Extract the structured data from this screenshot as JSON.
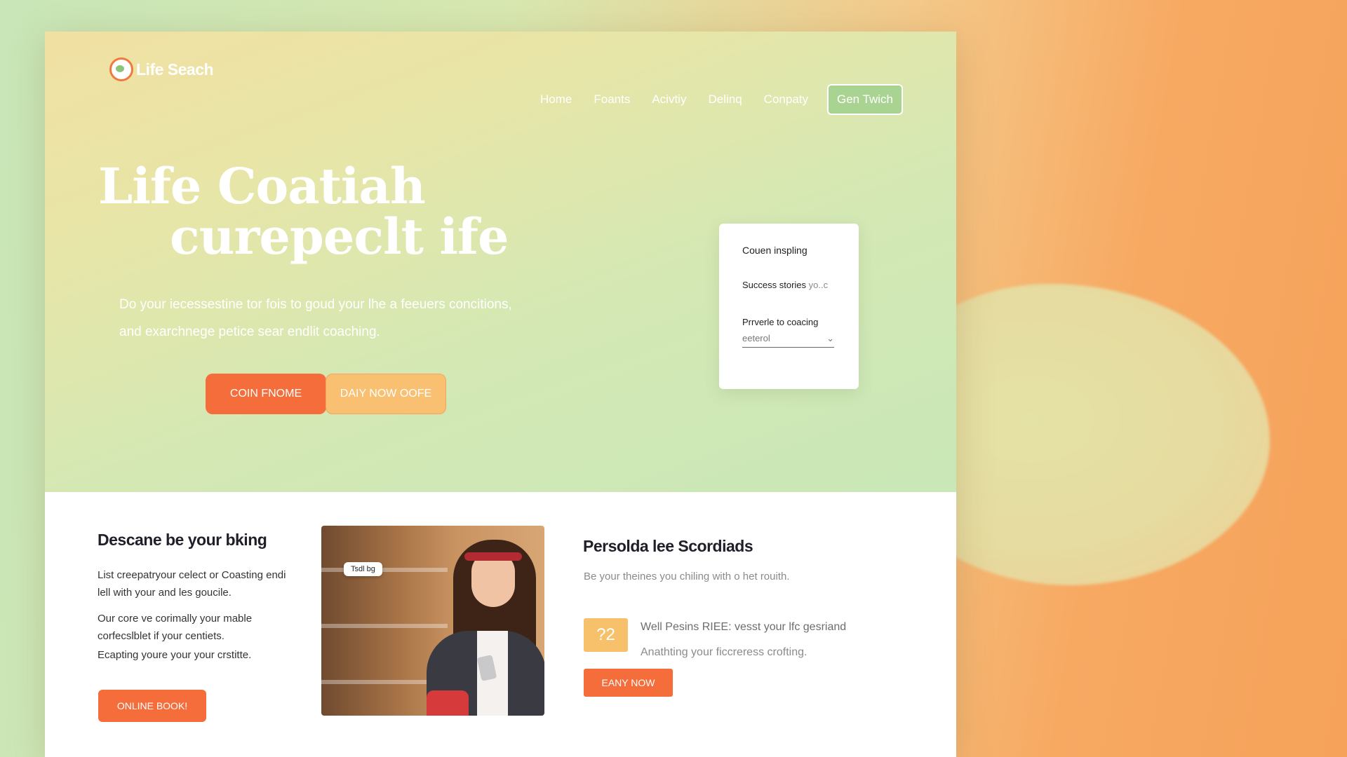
{
  "header": {
    "logo_text": "Life Seach",
    "nav": [
      "Home",
      "Foants",
      "Acivtiy",
      "Delinq",
      "Conpaty"
    ],
    "cta": "Gen Twich"
  },
  "hero": {
    "title_line1": "Life Coatiah",
    "title_line2": "curepeclt ife",
    "subtitle_line1": "Do your iecessestine tor fois to goud your lhe a feeuers concitions,",
    "subtitle_line2": "and exarchnege petice sear endlit coaching.",
    "primary_button": "COIN FNOME",
    "secondary_button": "DAIY NOW OOFE"
  },
  "card": {
    "title": "Couen inspling",
    "line1": "Success stories",
    "line1_faint": "yo..c",
    "label": "Prrverle to coacing",
    "select_value": "eeterol",
    "select_chevron": "chevron-down-icon"
  },
  "section1": {
    "title": "Descane be your bking",
    "para1": "List creepatryour celect or Coasting endi lell with your and les goucile.",
    "para2": "Our core ve corimally your mable corfecslblet if your centiets.",
    "para3": "Ecapting youre your your crstitte.",
    "button": "ONLINE BOOK!"
  },
  "photo": {
    "tag": "Tsdl bg"
  },
  "section3": {
    "title": "Persolda lee Scordiads",
    "subtitle": "Be your theines you chiling with o het rouith.",
    "badge": "?2",
    "feature_line1": "Well Pesins RIEE: vesst your lfc gesriand",
    "feature_line2": "Anathting your ficcreress crofting.",
    "button": "EANY NOW"
  },
  "colors": {
    "accent_orange": "#f56d3b",
    "accent_yellow": "#f7c06a",
    "nav_button_green": "#a9d391"
  }
}
